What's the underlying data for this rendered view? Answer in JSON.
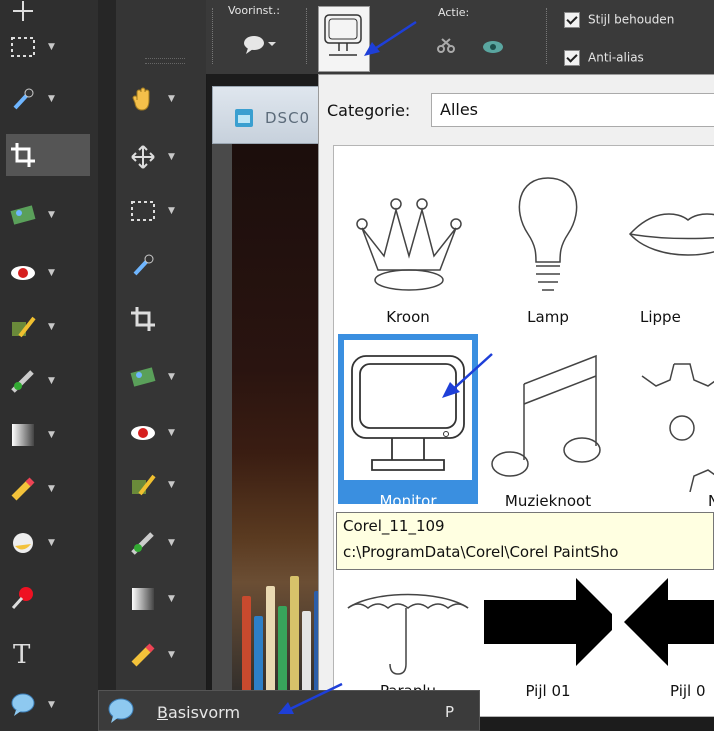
{
  "toolbar": {
    "preset_label": "Voorinst.:",
    "action_label": "Actie:",
    "keep_style_label": "Stijl behouden",
    "antialias_label": "Anti-alias"
  },
  "document": {
    "tab_title": "DSC0"
  },
  "picker": {
    "category_label": "Categorie:",
    "category_value": "Alles",
    "shapes": [
      {
        "label": "Kroon"
      },
      {
        "label": "Lamp"
      },
      {
        "label": "Lippe"
      },
      {
        "label": "Monitor"
      },
      {
        "label": "Muzieknoot"
      },
      {
        "label": "Nol"
      },
      {
        "label": "Paraplu"
      },
      {
        "label": "Pijl 01"
      },
      {
        "label": "Pijl 0"
      }
    ],
    "selected_shape": "Monitor"
  },
  "tooltip": {
    "name": "Corel_11_109",
    "path": "c:\\ProgramData\\Corel\\Corel PaintSho"
  },
  "flyout": {
    "label": "Basisvorm",
    "shortcut": "P"
  },
  "colors": {
    "selection_blue": "#3a8fe0",
    "annotation_arrow": "#1e3fd8",
    "tooltip_bg": "#ffffe1"
  }
}
